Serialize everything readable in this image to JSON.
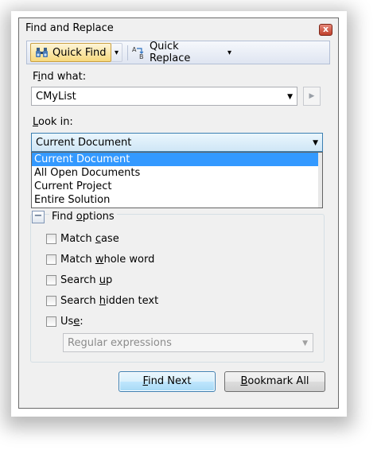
{
  "window": {
    "title": "Find and Replace",
    "close_glyph": "x"
  },
  "toolbar": {
    "quick_find_label": "Quick Find",
    "quick_replace_label": "Quick Replace",
    "dropdown_glyph": "▾"
  },
  "find_what": {
    "label_pre": "F",
    "label_u": "i",
    "label_post": "nd what:",
    "value": "CMyList",
    "go_glyph": "▶"
  },
  "look_in": {
    "label_pre": "",
    "label_u": "L",
    "label_post": "ook in:",
    "selected": "Current Document",
    "options": [
      "Current Document",
      "All Open Documents",
      "Current Project",
      "Entire Solution"
    ]
  },
  "find_options": {
    "collapse_glyph": "−",
    "title_pre": "Find ",
    "title_u": "o",
    "title_post": "ptions",
    "checkboxes": [
      {
        "pre": "Match ",
        "u": "c",
        "post": "ase",
        "checked": false
      },
      {
        "pre": "Match ",
        "u": "w",
        "post": "hole word",
        "checked": false
      },
      {
        "pre": "Search ",
        "u": "u",
        "post": "p",
        "checked": false
      },
      {
        "pre": "Search ",
        "u": "h",
        "post": "idden text",
        "checked": false
      },
      {
        "pre": "Us",
        "u": "e",
        "post": ":",
        "checked": false
      }
    ],
    "use_value": "Regular expressions"
  },
  "buttons": {
    "find_next_u": "F",
    "find_next_post": "ind Next",
    "bookmark_u": "B",
    "bookmark_post": "ookmark All"
  },
  "colors": {
    "selection": "#3399ff",
    "window_bg": "#f0f0f0",
    "close_red": "#c0402b"
  }
}
